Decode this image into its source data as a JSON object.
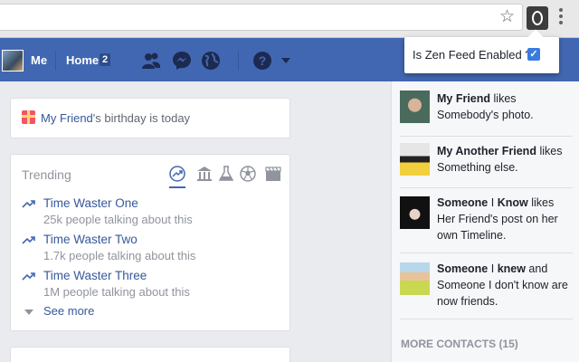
{
  "extension_popup": {
    "label": "Is Zen Feed Enabled ?",
    "checked": true,
    "check_glyph": "✓"
  },
  "navbar": {
    "me_label": "Me",
    "home_label": "Home",
    "home_count": "2",
    "icons": [
      "friends-icon",
      "messenger-icon",
      "globe-icon",
      "help-icon",
      "caret-down-icon"
    ],
    "brand_color": "#4267b2"
  },
  "birthday": {
    "friend_name": "My Friend",
    "suffix": "'s birthday is today"
  },
  "trending": {
    "title": "Trending",
    "categories": [
      "trending-icon",
      "politics-icon",
      "science-icon",
      "sports-icon",
      "entertainment-icon"
    ],
    "items": [
      {
        "title": "Time Waster One",
        "sub": "25k people talking about this"
      },
      {
        "title": "Time Waster Two",
        "sub": "1.7k people talking about this"
      },
      {
        "title": "Time Waster Three",
        "sub": "1M people talking about this"
      }
    ],
    "see_more": "See more"
  },
  "ticker": {
    "items": [
      {
        "name": "My Friend",
        "rest": " likes Somebody's photo."
      },
      {
        "name": "My Another Friend",
        "rest": " likes Something else."
      },
      {
        "name": "Someone",
        "rest_mid": " I ",
        "name2": "Know",
        "rest": " likes Her Friend's post on her own Timeline."
      },
      {
        "name": "Someone",
        "rest_mid": " I ",
        "name2": "knew",
        "rest": " and Someone I don't know are now friends."
      }
    ],
    "more_contacts": "MORE CONTACTS (15)"
  }
}
